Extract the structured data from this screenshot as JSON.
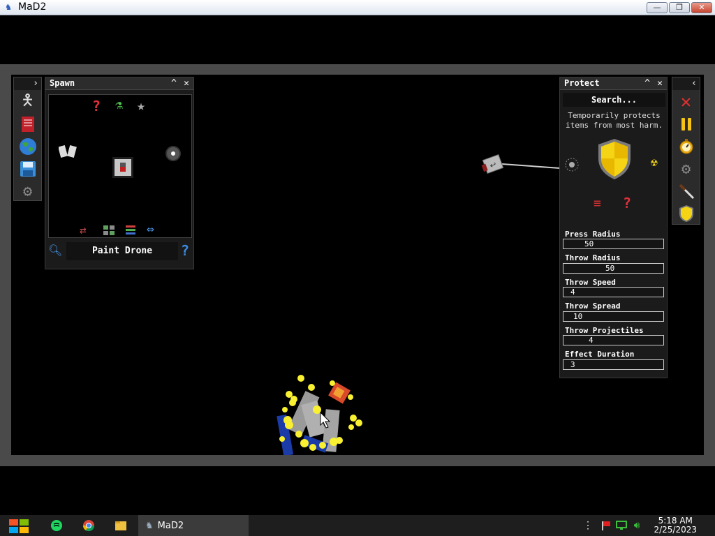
{
  "window": {
    "title": "MaD2",
    "minimize_label": "—",
    "maximize_label": "❐",
    "close_label": "✕"
  },
  "left_toolbar": {
    "toggle": "›",
    "icons": [
      "figure-icon",
      "book-icon",
      "globe-icon",
      "save-icon",
      "gear-icon"
    ]
  },
  "spawn_panel": {
    "title": "Spawn",
    "minimize": "^",
    "close": "✕",
    "top_icons": [
      "question-icon",
      "flask-icon",
      "star-icon"
    ],
    "bottom_icons": [
      "swap-icon",
      "grid-icon",
      "list-icon",
      "arrows-icon"
    ],
    "selected_item": "Paint Drone",
    "help": "?"
  },
  "protect_panel": {
    "title": "Protect",
    "minimize": "^",
    "close": "✕",
    "search_placeholder": "Search...",
    "description": "Temporarily protects items from most harm.",
    "settings": [
      {
        "label": "Press Radius",
        "value": "50"
      },
      {
        "label": "Throw Radius",
        "value": "50"
      },
      {
        "label": "Throw Speed",
        "value": "4"
      },
      {
        "label": "Throw Spread",
        "value": "10"
      },
      {
        "label": "Throw Projectiles",
        "value": "4"
      },
      {
        "label": "Effect Duration",
        "value": "3"
      }
    ]
  },
  "right_toolbar": {
    "toggle": "‹",
    "icons": [
      "close-icon",
      "pause-icon",
      "stopwatch-icon",
      "gear-icon",
      "knife-icon",
      "shield-icon"
    ]
  },
  "taskbar": {
    "active_app": "MaD2",
    "time": "5:18 AM",
    "date": "2/25/2023"
  },
  "colors": {
    "accent_red": "#e03030",
    "shield_yellow": "#f5d416",
    "particle_yellow": "#f8f030"
  }
}
